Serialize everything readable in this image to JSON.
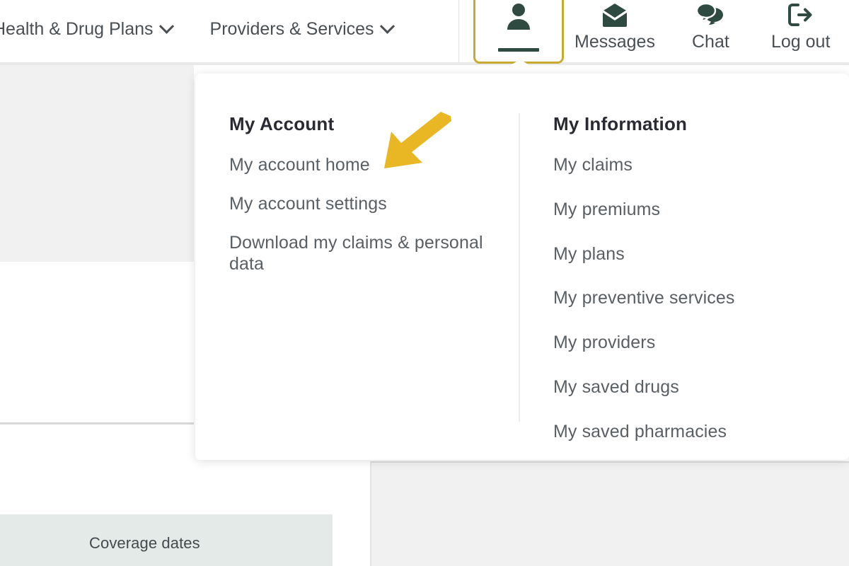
{
  "topnav": {
    "links": [
      {
        "label": "Health & Drug Plans",
        "icon": "chevron-down-icon"
      },
      {
        "label": "Providers & Services",
        "icon": "chevron-down-icon"
      }
    ],
    "account_button": {
      "icon": "user-account-icon",
      "state": "active-focused"
    },
    "actions": [
      {
        "label": "Messages",
        "icon": "envelope-icon"
      },
      {
        "label": "Chat",
        "icon": "chat-bubbles-icon"
      },
      {
        "label": "Log out",
        "icon": "logout-exit-icon"
      }
    ]
  },
  "dropdown": {
    "left_column": {
      "heading": "My Account",
      "items": [
        "My account home",
        "My account settings",
        "Download my claims & personal data"
      ]
    },
    "right_column": {
      "heading": "My Information",
      "items": [
        "My claims",
        "My premiums",
        "My plans",
        "My preventive services",
        "My providers",
        "My saved drugs",
        "My saved pharmacies"
      ]
    }
  },
  "annotation": {
    "arrow": {
      "icon": "arrow-pointing-down-left-icon",
      "target": "My account home",
      "color": "#e8b723"
    }
  },
  "background": {
    "coverage_panel_label": "Coverage dates"
  },
  "colors": {
    "accent_gold": "#c9a92f",
    "annotation_yellow": "#e8b723",
    "icon_green": "#2f4a40",
    "heading_text": "#2a2a33",
    "link_text": "#5a5f64",
    "nav_text": "#4a4f54",
    "panel_bg": "#e3eae8",
    "navy_strip": "#2e2a4f",
    "page_gray": "#f1f1f1"
  }
}
